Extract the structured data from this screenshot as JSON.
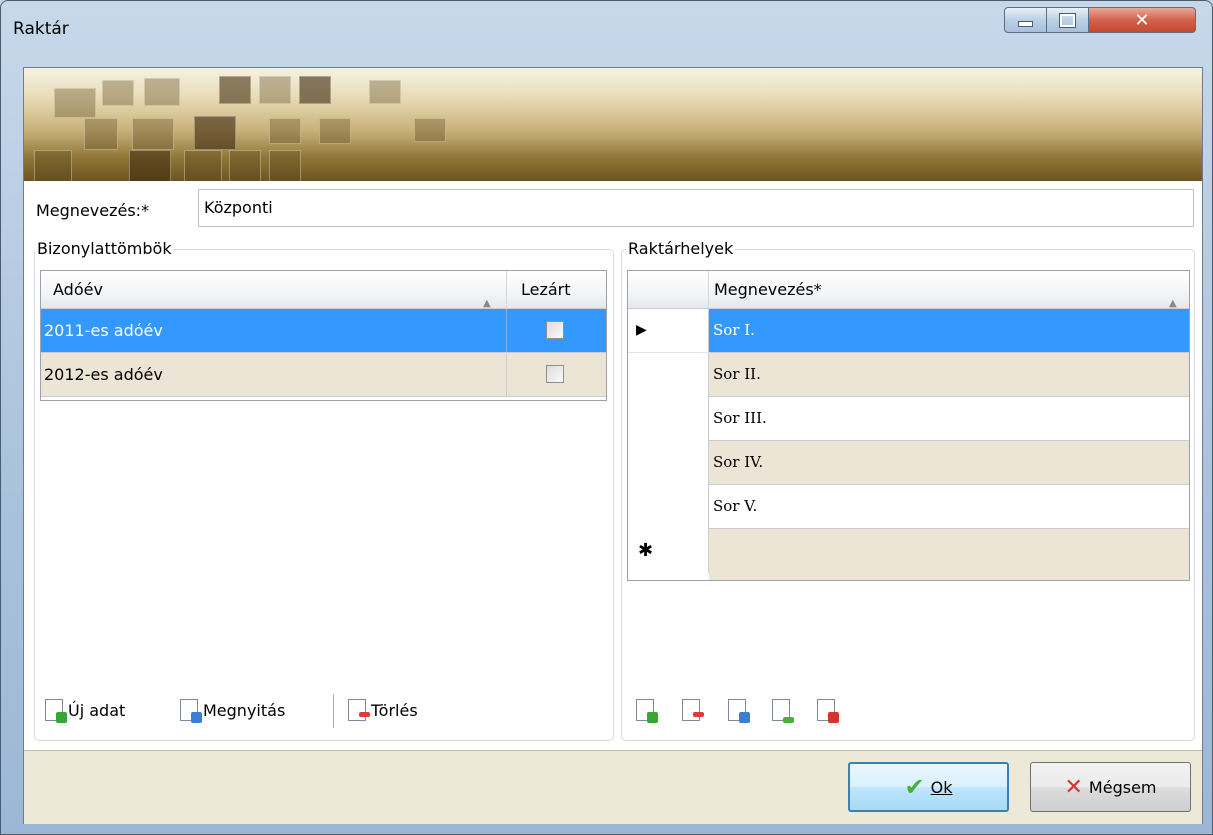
{
  "window": {
    "title": "Raktár"
  },
  "form": {
    "name_label": "Megnevezés:*",
    "name_value": "Központi"
  },
  "left_group": {
    "title": "Bizonylattömbök",
    "columns": [
      "Adóév",
      "Lezárt"
    ],
    "rows": [
      {
        "label": "2011-es adóév",
        "closed": false,
        "selected": true
      },
      {
        "label": "2012-es adóév",
        "closed": false,
        "selected": false
      }
    ],
    "toolbar": {
      "new": "Új adat",
      "open": "Megnyitás",
      "delete": "Törlés"
    }
  },
  "right_group": {
    "title": "Raktárhelyek",
    "column": "Megnevezés*",
    "rows": [
      "Sor I.",
      "Sor II.",
      "Sor III.",
      "Sor IV.",
      "Sor V."
    ],
    "current_row_marker": "▶",
    "new_row_marker": "✱"
  },
  "footer": {
    "ok": "Ok",
    "cancel": "Mégsem"
  },
  "colors": {
    "selection": "#3399ff",
    "alt_row": "#ece4d4",
    "banner": "#8f7536"
  }
}
